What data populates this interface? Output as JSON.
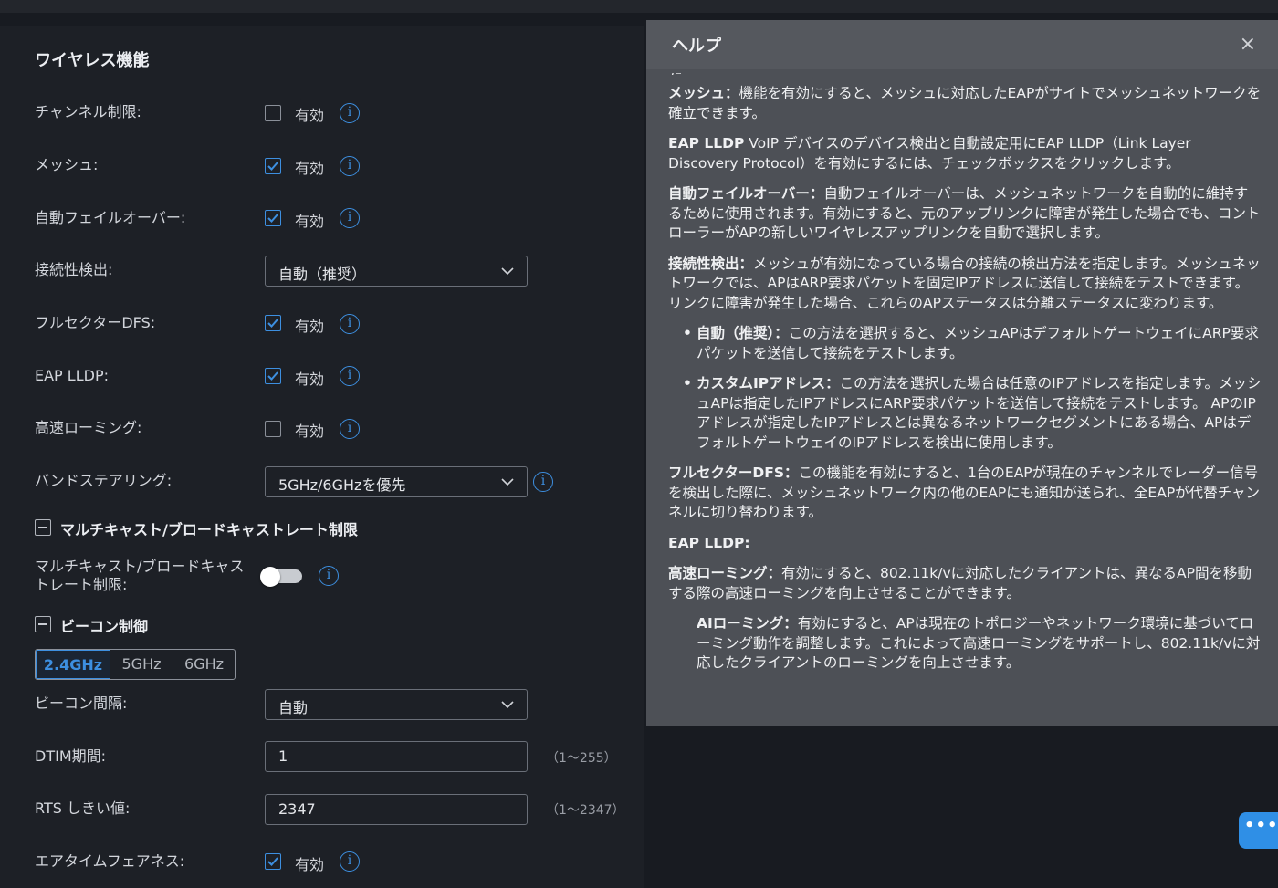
{
  "section": {
    "title": "ワイヤレス機能"
  },
  "checkbox_text": "有効",
  "rows": {
    "channel_limit": {
      "label": "チャンネル制限:",
      "checked": false
    },
    "mesh": {
      "label": "メッシュ:",
      "checked": true
    },
    "auto_failover": {
      "label": "自動フェイルオーバー:",
      "checked": true
    },
    "connectivity": {
      "label": "接続性検出:",
      "value": "自動（推奨）"
    },
    "full_sector_dfs": {
      "label": "フルセクターDFS:",
      "checked": true
    },
    "eap_lldp": {
      "label": "EAP LLDP:",
      "checked": true
    },
    "fast_roaming": {
      "label": "高速ローミング:",
      "checked": false
    },
    "band_steering": {
      "label": "バンドステアリング:",
      "value": "5GHz/6GHzを優先"
    },
    "multicast_section": {
      "title": "マルチキャスト/ブロードキャストレート制限"
    },
    "multicast_limit": {
      "label_line1": "マルチキャスト/ブロードキャス",
      "label_line2": "トレート制限:",
      "enabled": false
    },
    "beacon_section": {
      "title": "ビーコン制御"
    },
    "bands": [
      "2.4GHz",
      "5GHz",
      "6GHz"
    ],
    "active_band": "2.4GHz",
    "beacon_interval": {
      "label": "ビーコン間隔:",
      "value": "自動"
    },
    "dtim": {
      "label": "DTIM期間:",
      "value": "1",
      "range": "（1〜255）"
    },
    "rts": {
      "label": "RTS しきい値:",
      "value": "2347",
      "range": "（1〜2347）"
    },
    "airtime": {
      "label": "エアタイムフェアネス:",
      "checked": true
    }
  },
  "help": {
    "title": "ヘルプ",
    "close": "×",
    "cut_text": "た。",
    "mesh_term": "メッシュ：",
    "mesh_desc": "機能を有効にすると、メッシュに対応したEAPがサイトでメッシュネットワークを確立できます。",
    "lldp_term": "EAP LLDP",
    "lldp_desc": " VoIP デバイスのデバイス検出と自動設定用にEAP LLDP（Link Layer Discovery Protocol）を有効にするには、チェックボックスをクリックします。",
    "failover_term": "自動フェイルオーバー：",
    "failover_desc": "自動フェイルオーバーは、メッシュネットワークを自動的に維持するために使用されます。有効にすると、元のアップリンクに障害が発生した場合でも、コントローラーがAPの新しいワイヤレスアップリンクを自動で選択します。",
    "detect_term": "接続性検出：",
    "detect_desc": "メッシュが有効になっている場合の接続の検出方法を指定します。メッシュネットワークでは、APはARP要求パケットを固定IPアドレスに送信して接続をテストできます。リンクに障害が発生した場合、これらのAPステータスは分離ステータスに変わります。",
    "auto_term": "自動（推奨）：",
    "auto_desc": "この方法を選択すると、メッシュAPはデフォルトゲートウェイにARP要求パケットを送信して接続をテストします。",
    "custom_term": "カスタムIPアドレス：",
    "custom_desc": "この方法を選択した場合は任意のIPアドレスを指定します。メッシュAPは指定したIPアドレスにARP要求パケットを送信して接続をテストします。 APのIPアドレスが指定したIPアドレスとは異なるネットワークセグメントにある場合、APはデフォルトゲートウェイのIPアドレスを検出に使用します。",
    "dfs_term": "フルセクターDFS：",
    "dfs_desc": "この機能を有効にすると、1台のEAPが現在のチャンネルでレーダー信号を検出した際に、メッシュネットワーク内の他のEAPにも通知が送られ、全EAPが代替チャンネルに切り替わります。",
    "lldp2_term": "EAP LLDP:",
    "roam_term": "高速ローミング：",
    "roam_desc": "有効にすると、802.11k/vに対応したクライアントは、異なるAP間を移動する際の高速ローミングを向上させることができます。",
    "ai_term": "AIローミング：",
    "ai_desc": "有効にすると、APは現在のトポロジーやネットワーク環境に基づいてローミング動作を調整します。これによって高速ローミングをサポートし、802.11k/vに対応したクライアントのローミングを向上させます。"
  },
  "chat": {
    "icon": "chat-bubble-icon",
    "text": "•••"
  },
  "colors": {
    "accent": "#3d8fe0",
    "panel": "#1d2026",
    "help_bg": "#4d5056"
  }
}
